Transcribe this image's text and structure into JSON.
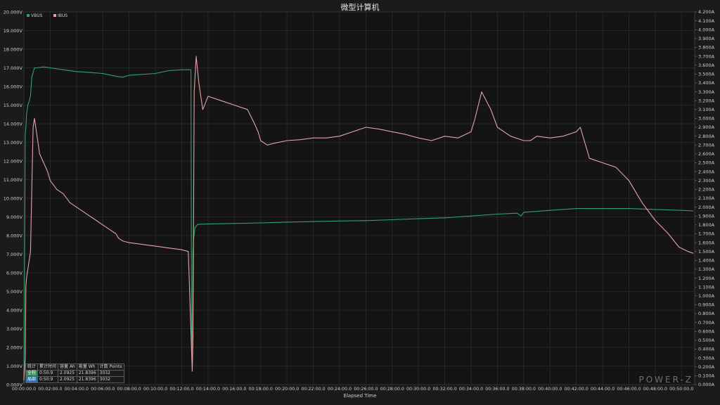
{
  "chart_data": {
    "type": "line",
    "title": "微型计算机",
    "xlabel": "Elapsed Time",
    "x_ticks": [
      "00:00:00.0",
      "00:02:00.0",
      "00:04:00.0",
      "00:06:00.0",
      "00:08:00.0",
      "00:10:00.0",
      "00:12:00.0",
      "00:14:00.0",
      "00:16:00.0",
      "00:18:00.0",
      "00:20:00.0",
      "00:22:00.0",
      "00:24:00.0",
      "00:26:00.0",
      "00:28:00.0",
      "00:30:00.0",
      "00:32:00.0",
      "00:34:00.0",
      "00:36:00.0",
      "00:38:00.0",
      "00:40:00.0",
      "00:42:00.0",
      "00:44:00.0",
      "00:46:00.0",
      "00:48:00.0",
      "00:50:00.0"
    ],
    "xlim_minutes": [
      0,
      51
    ],
    "y_left": {
      "ylim": [
        0,
        20
      ],
      "step": 1,
      "unit": "V",
      "decimals": 3
    },
    "y_right": {
      "ylim": [
        0,
        4.2
      ],
      "step": 0.1,
      "unit": "A",
      "decimals": 3
    },
    "grid": true,
    "legend_position": "top-left",
    "series": [
      {
        "name": "VBUS",
        "axis": "left",
        "color": "#2fa36b",
        "x": [
          0,
          0.1,
          0.15,
          0.2,
          0.3,
          0.4,
          0.5,
          0.6,
          0.8,
          1,
          1.5,
          2,
          3,
          4,
          5,
          6,
          7,
          7.5,
          8,
          9,
          10,
          11,
          12,
          12.5,
          12.7,
          12.75,
          12.8,
          12.85,
          12.9,
          13,
          13.2,
          14,
          16,
          18,
          20,
          22,
          24,
          26,
          28,
          30,
          32,
          34,
          36,
          37.5,
          37.8,
          38,
          40,
          42,
          44,
          46,
          48,
          50,
          50.9
        ],
        "y": [
          0.05,
          13.4,
          13.8,
          14.5,
          15,
          15.2,
          15.5,
          16.5,
          17,
          17,
          17.05,
          17,
          16.9,
          16.8,
          16.75,
          16.7,
          16.55,
          16.5,
          16.6,
          16.65,
          16.7,
          16.85,
          16.9,
          16.9,
          16.9,
          2,
          1.5,
          7,
          7.8,
          8.4,
          8.6,
          8.62,
          8.65,
          8.68,
          8.72,
          8.75,
          8.78,
          8.8,
          8.85,
          8.9,
          8.95,
          9.05,
          9.15,
          9.2,
          9.05,
          9.25,
          9.35,
          9.45,
          9.45,
          9.45,
          9.4,
          9.35,
          9.32
        ]
      },
      {
        "name": "IBUS",
        "axis": "right",
        "color": "#e6a2aa",
        "x": [
          0,
          0.1,
          0.15,
          0.2,
          0.3,
          0.5,
          0.6,
          0.7,
          0.8,
          1,
          1.2,
          1.5,
          1.8,
          2,
          2.5,
          3,
          3.5,
          4,
          4.5,
          5,
          5.5,
          6,
          6.5,
          7,
          7.2,
          7.5,
          8,
          9,
          10,
          11,
          12,
          12.5,
          12.7,
          12.8,
          12.85,
          12.95,
          13.1,
          13.3,
          13.6,
          14,
          15,
          16,
          17,
          17.5,
          17.8,
          18,
          18.5,
          19,
          20,
          21,
          22,
          23,
          24,
          25,
          26,
          27,
          28,
          29,
          30,
          31,
          32,
          33,
          34,
          34.3,
          34.8,
          35.5,
          36,
          37,
          38,
          38.5,
          39,
          40,
          41,
          42,
          42.3,
          43,
          44,
          45,
          46,
          47,
          48,
          49,
          49.8,
          50.5,
          50.9
        ],
        "y": [
          0.05,
          0.3,
          1.1,
          1.2,
          1.3,
          1.5,
          2.2,
          2.9,
          3.0,
          2.8,
          2.6,
          2.5,
          2.4,
          2.3,
          2.2,
          2.15,
          2.05,
          2.0,
          1.95,
          1.9,
          1.85,
          1.8,
          1.75,
          1.7,
          1.65,
          1.62,
          1.6,
          1.58,
          1.56,
          1.54,
          1.52,
          1.5,
          0.6,
          0.15,
          0.5,
          3.3,
          3.7,
          3.4,
          3.1,
          3.25,
          3.2,
          3.15,
          3.1,
          2.95,
          2.85,
          2.75,
          2.7,
          2.72,
          2.75,
          2.76,
          2.78,
          2.78,
          2.8,
          2.85,
          2.9,
          2.88,
          2.85,
          2.82,
          2.78,
          2.75,
          2.8,
          2.78,
          2.85,
          3.0,
          3.3,
          3.1,
          2.9,
          2.8,
          2.75,
          2.75,
          2.8,
          2.78,
          2.8,
          2.85,
          2.9,
          2.55,
          2.5,
          2.45,
          2.3,
          2.05,
          1.85,
          1.7,
          1.55,
          1.5,
          1.48
        ]
      }
    ]
  },
  "stats_table": {
    "header": [
      "统计",
      "累计时间",
      "容量 Ah",
      "能量 Wh",
      "计数 Points"
    ],
    "rows": [
      [
        "全程",
        "0:50:9",
        "2.0925",
        "21.8396",
        "3032"
      ],
      [
        "局部",
        "0:50:9",
        "2.0925",
        "21.8396",
        "3032"
      ]
    ]
  },
  "logo": "POWER-Z"
}
